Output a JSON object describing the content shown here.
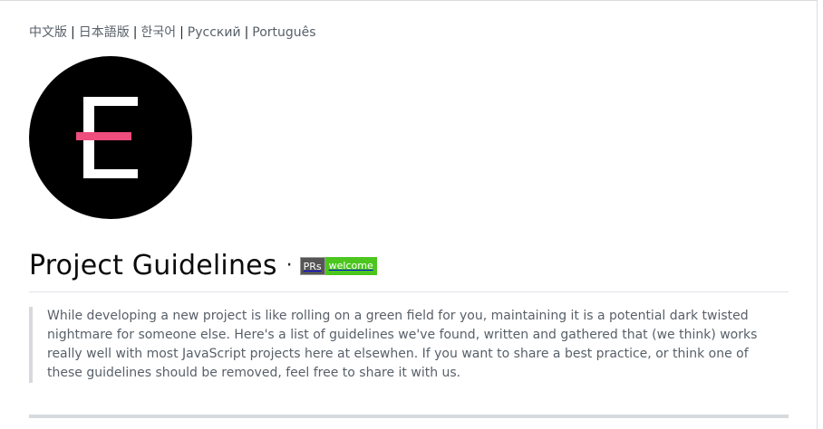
{
  "languages": [
    {
      "label": "中文版"
    },
    {
      "label": "日本語版"
    },
    {
      "label": "한국어"
    },
    {
      "label": "Русский"
    },
    {
      "label": "Português"
    }
  ],
  "separator": "|",
  "logo": {
    "name": "elsewhen-e-logo",
    "colors": {
      "background": "#000000",
      "letter": "#ffffff",
      "accent": "#ee4d7d"
    }
  },
  "heading": {
    "title": "Project Guidelines",
    "dot": "·",
    "badge": {
      "left": "PRs",
      "right": "welcome",
      "right_color": "#4cc61e"
    }
  },
  "intro": "While developing a new project is like rolling on a green field for you, maintaining it is a potential dark twisted nightmare for someone else. Here's a list of guidelines we've found, written and gathered that (we think) works really well with most JavaScript projects here at elsewhen. If you want to share a best practice, or think one of these guidelines should be removed, feel free to share it with us."
}
